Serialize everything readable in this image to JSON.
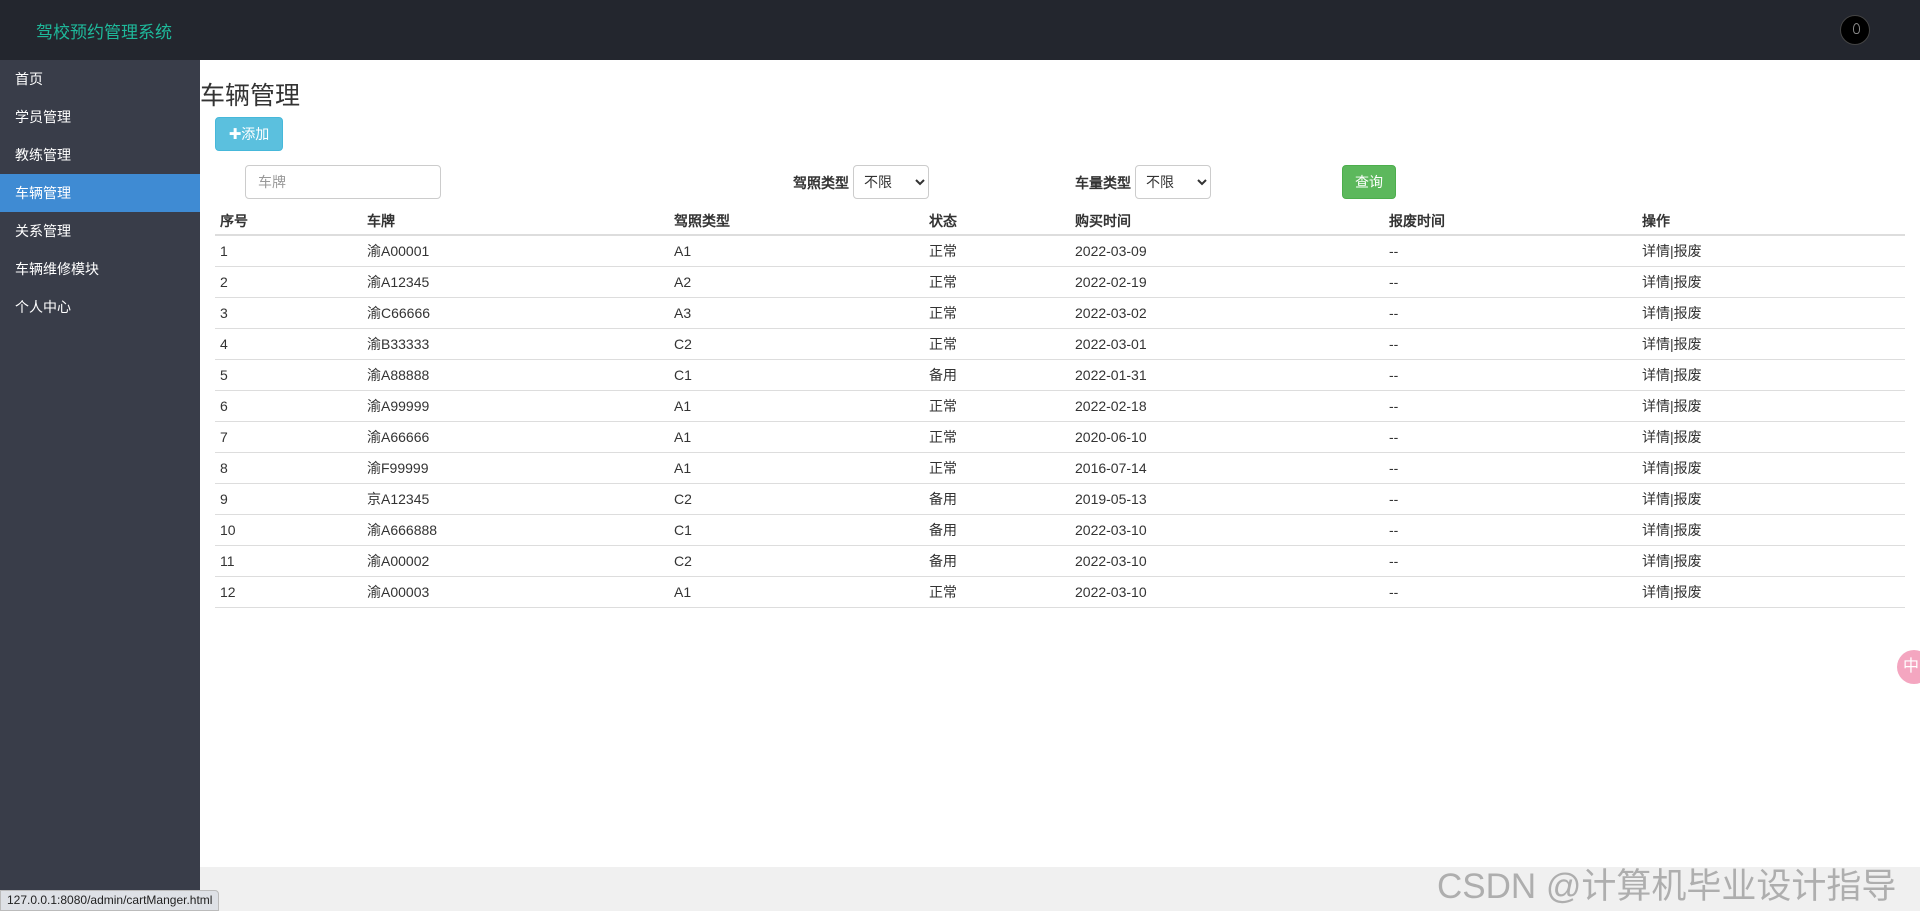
{
  "app": {
    "brand": "驾校预约管理系统"
  },
  "sidebar": {
    "items": [
      {
        "label": "首页"
      },
      {
        "label": "学员管理"
      },
      {
        "label": "教练管理"
      },
      {
        "label": "车辆管理"
      },
      {
        "label": "关系管理"
      },
      {
        "label": "车辆维修模块"
      },
      {
        "label": "个人中心"
      }
    ],
    "active_index": 3
  },
  "page": {
    "title": "车辆管理"
  },
  "toolbar": {
    "add_icon": "plus-icon",
    "add_label": "添加"
  },
  "filters": {
    "plate_placeholder": "车牌",
    "license_type_label": "驾照类型",
    "license_type_value": "不限",
    "vehicle_type_label": "车量类型",
    "vehicle_type_value": "不限",
    "search_label": "查询"
  },
  "table": {
    "headers": [
      "序号",
      "车牌",
      "驾照类型",
      "状态",
      "购买时间",
      "报废时间",
      "操作"
    ],
    "rows": [
      [
        "1",
        "渝A00001",
        "A1",
        "正常",
        "2022-03-09",
        "--"
      ],
      [
        "2",
        "渝A12345",
        "A2",
        "正常",
        "2022-02-19",
        "--"
      ],
      [
        "3",
        "渝C66666",
        "A3",
        "正常",
        "2022-03-02",
        "--"
      ],
      [
        "4",
        "渝B33333",
        "C2",
        "正常",
        "2022-03-01",
        "--"
      ],
      [
        "5",
        "渝A88888",
        "C1",
        "备用",
        "2022-01-31",
        "--"
      ],
      [
        "6",
        "渝A99999",
        "A1",
        "正常",
        "2022-02-18",
        "--"
      ],
      [
        "7",
        "渝A66666",
        "A1",
        "正常",
        "2020-06-10",
        "--"
      ],
      [
        "8",
        "渝F99999",
        "A1",
        "正常",
        "2016-07-14",
        "--"
      ],
      [
        "9",
        "京A12345",
        "C2",
        "备用",
        "2019-05-13",
        "--"
      ],
      [
        "10",
        "渝A666888",
        "C1",
        "备用",
        "2022-03-10",
        "--"
      ],
      [
        "11",
        "渝A00002",
        "C2",
        "备用",
        "2022-03-10",
        "--"
      ],
      [
        "12",
        "渝A00003",
        "A1",
        "正常",
        "2022-03-10",
        "--"
      ]
    ],
    "op_detail": "详情",
    "op_separator": "|",
    "op_scrap": "报废"
  },
  "status_bar": {
    "url": "127.0.0.1:8080/admin/cartManger.html"
  },
  "watermark": "CSDN @计算机毕业设计指导",
  "float_widget": {
    "label": "中"
  },
  "colors": {
    "topbar": "#23262e",
    "sidebar": "#393d49",
    "nav_active": "#3f8bd3",
    "brand_text": "#1eb89a",
    "add_button": "#5bc0de",
    "search_button": "#5cb85c"
  }
}
